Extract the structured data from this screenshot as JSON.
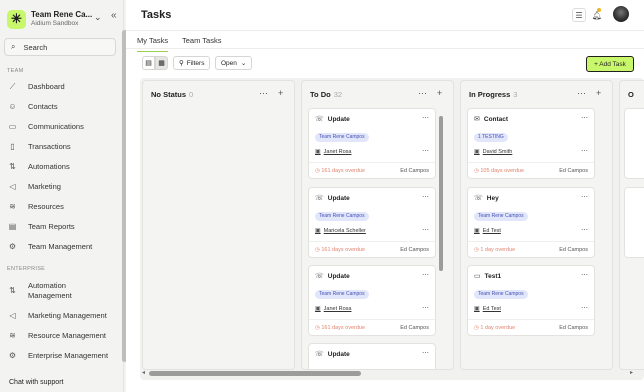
{
  "workspace": {
    "name": "Team Rene Ca...",
    "sub": "Aidium Sandbox"
  },
  "search": {
    "label": "Search"
  },
  "sidebar": {
    "team_heading": "TEAM",
    "team_items": [
      {
        "label": "Dashboard",
        "icon": "chart-icon"
      },
      {
        "label": "Contacts",
        "icon": "contacts-icon"
      },
      {
        "label": "Communications",
        "icon": "chat-icon"
      },
      {
        "label": "Transactions",
        "icon": "file-icon"
      },
      {
        "label": "Automations",
        "icon": "automation-icon"
      },
      {
        "label": "Marketing",
        "icon": "megaphone-icon"
      },
      {
        "label": "Resources",
        "icon": "database-icon"
      },
      {
        "label": "Team Reports",
        "icon": "report-icon"
      },
      {
        "label": "Team Management",
        "icon": "gear-icon"
      }
    ],
    "enterprise_heading": "ENTERPRISE",
    "enterprise_items": [
      {
        "label": "Automation Management"
      },
      {
        "label": "Marketing Management"
      },
      {
        "label": "Resource Management"
      },
      {
        "label": "Enterprise Management"
      }
    ],
    "chat_support": "Chat with support"
  },
  "header": {
    "title": "Tasks"
  },
  "tabs": {
    "my_tasks": "My Tasks",
    "team_tasks": "Team Tasks"
  },
  "toolbar": {
    "filters": "Filters",
    "open": "Open",
    "add_task": "+ Add Task"
  },
  "colors": {
    "accent": "#c9f76b",
    "tag_bg": "#e2e6fb",
    "tag_text": "#4353b5",
    "overdue": "#e0836e"
  },
  "columns": [
    {
      "title": "No Status",
      "count": "0"
    },
    {
      "title": "To Do",
      "count": "32"
    },
    {
      "title": "In Progress",
      "count": "3"
    },
    {
      "title": "O"
    }
  ],
  "todo_cards": [
    {
      "title": "Update",
      "tag": "Team Rene Campos",
      "related": "Janet Rosa",
      "due": "161 days overdue",
      "assignee": "Ed Campos"
    },
    {
      "title": "Update",
      "tag": "Team Rene Campos",
      "related": "Maricela Scheller",
      "due": "161 days overdue",
      "assignee": "Ed Campos"
    },
    {
      "title": "Update",
      "tag": "Team Rene Campos",
      "related": "Janet Rosa",
      "due": "161 days overdue",
      "assignee": "Ed Campos"
    },
    {
      "title": "Update"
    }
  ],
  "progress_cards": [
    {
      "title": "Contact",
      "tag": "1 TESTING",
      "related": "David Smith",
      "due": "105 days overdue",
      "assignee": "Ed Campos"
    },
    {
      "title": "Hey",
      "tag": "Team Rene Campos",
      "related": "Ed Test",
      "due": "1 day overdue",
      "assignee": "Ed Campos"
    },
    {
      "title": "Test1",
      "tag": "Team Rene Campos",
      "related": "Ed Test",
      "due": "1 day overdue",
      "assignee": "Ed Campos"
    }
  ]
}
